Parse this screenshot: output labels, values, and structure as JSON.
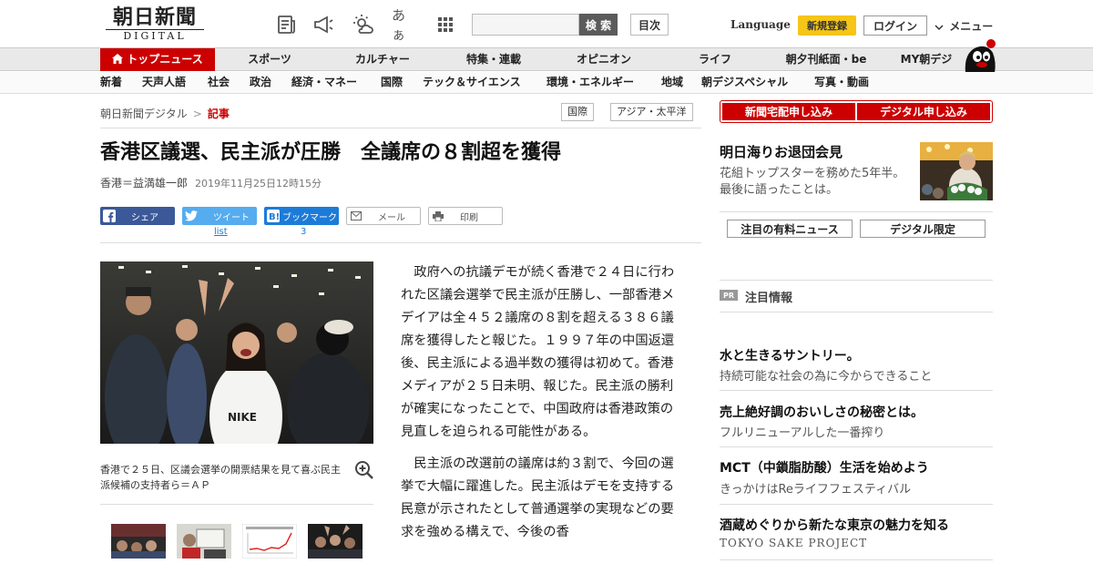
{
  "header": {
    "logo_main": "朝日新聞",
    "logo_sub": "DIGITAL",
    "aa_label": "あぁ",
    "search_placeholder": "",
    "search_button": "検 索",
    "toc_button": "目次",
    "language": "Language",
    "register": "新規登録",
    "login": "ログイン",
    "menu": "メニュー"
  },
  "main_nav": [
    "トップニュース",
    "スポーツ",
    "カルチャー",
    "特集・連載",
    "オピニオン",
    "ライフ",
    "朝夕刊紙面・be",
    "MY朝デジ"
  ],
  "sub_nav": [
    "新着",
    "天声人語",
    "社会",
    "政治",
    "経済・マネー",
    "国際",
    "テック＆サイエンス",
    "環境・エネルギー",
    "地域",
    "朝デジスペシャル",
    "写真・動画"
  ],
  "breadcrumb": {
    "home": "朝日新聞デジタル",
    "separator": ">",
    "current": "記事"
  },
  "tags": [
    "国際",
    "アジア・太平洋"
  ],
  "article": {
    "headline": "香港区議選、民主派が圧勝　全議席の８割超を獲得",
    "author": "香港＝益満雄一郎",
    "date": "2019年11月25日12時15分",
    "share": {
      "facebook": "シェア",
      "twitter": "ツイート",
      "hatena": "ブックマーク",
      "mail": "メール",
      "print": "印刷",
      "twitter_count": "list",
      "hatena_count": "3"
    },
    "caption": "香港で２５日、区議会選挙の開票結果を見て喜ぶ民主派候補の支持者ら＝ＡＰ",
    "paragraphs": [
      "政府への抗議デモが続く香港で２４日に行われた区議会選挙で民主派が圧勝し、一部香港メデイアは全４５２議席の８割を超える３８６議席を獲得したと報じた。１９９７年の中国返還後、民主派による過半数の獲得は初めて。香港メディアが２５日未明、報じた。民主派の勝利が確実になったことで、中国政府は香港政策の見直しを迫られる可能性がある。",
      "民主派の改選前の議席は約３割で、今回の選挙で大幅に躍進した。民主派はデモを支持する民意が示されたとして普通選挙の実現などの要求を強める構えで、今後の香"
    ]
  },
  "sidebar": {
    "subscribe_paper": "新聞宅配申し込み",
    "subscribe_digital": "デジタル申し込み",
    "promo_title": "明日海りお退団会見",
    "promo_desc": "花組トップスターを務めた5年半。最後に語ったことは。",
    "btn_paid_news": "注目の有料ニュース",
    "btn_digital_only": "デジタル限定",
    "pr_badge": "PR",
    "pr_label": "注目情報",
    "ads": [
      {
        "title": "水と生きるサントリー。",
        "desc": "持続可能な社会の為に今からできること"
      },
      {
        "title": "売上絶好調のおいしさの秘密とは。",
        "desc": "フルリニューアルした一番搾り"
      },
      {
        "title": "MCT（中鎖脂肪酸）生活を始めよう",
        "desc": "きっかけはReライフフェスティバル"
      },
      {
        "title": "酒蔵めぐりから新たな東京の魅力を知る",
        "desc": "TOKYO SAKE PROJECT"
      }
    ]
  },
  "colors": {
    "brand_red": "#cc0000",
    "register_yellow": "#f5c518",
    "facebook": "#3b5998",
    "twitter": "#55acee",
    "hatena": "#1d7bd8"
  }
}
